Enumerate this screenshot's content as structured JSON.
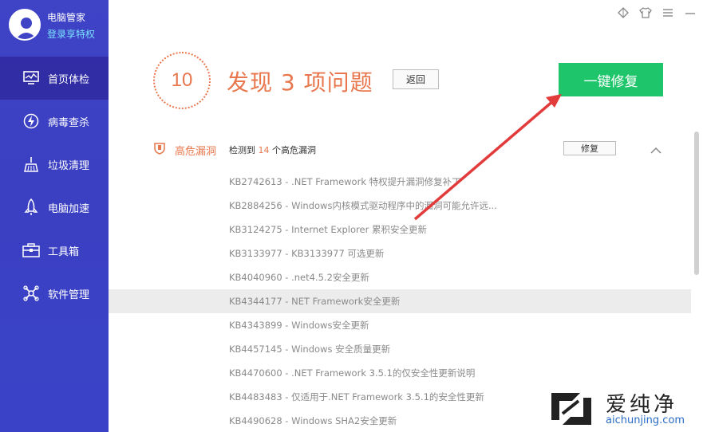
{
  "sidebar": {
    "app_name": "电脑管家",
    "login_text": "登录享特权",
    "items": [
      {
        "label": "首页体检",
        "icon": "monitor-icon",
        "active": true
      },
      {
        "label": "病毒查杀",
        "icon": "lightning-icon",
        "active": false
      },
      {
        "label": "垃圾清理",
        "icon": "broom-icon",
        "active": false
      },
      {
        "label": "电脑加速",
        "icon": "rocket-icon",
        "active": false
      },
      {
        "label": "工具箱",
        "icon": "toolbox-icon",
        "active": false
      },
      {
        "label": "软件管理",
        "icon": "apps-icon",
        "active": false
      }
    ]
  },
  "window_controls": [
    "diamond-icon",
    "shirt-icon",
    "menu-icon",
    "minimize-icon"
  ],
  "summary": {
    "score": "10",
    "headline": "发现 3 项问题",
    "back_label": "返回",
    "fix_all_label": "一键修复"
  },
  "section": {
    "title": "高危漏洞",
    "detect_prefix": "检测到 ",
    "detect_count": "14",
    "detect_suffix": " 个高危漏洞",
    "fix_label": "修复"
  },
  "items": [
    "KB2742613 - .NET Framework 特权提升漏洞修复补丁",
    "KB2884256 - Windows内核模式驱动程序中的漏洞可能允许远...",
    "KB3124275 - Internet Explorer 累积安全更新",
    "KB3133977 - KB3133977 可选更新",
    "KB4040960 - .net4.5.2安全更新",
    "KB4344177 - NET Framework安全更新",
    "KB4343899 - Windows安全更新",
    "KB4457145 - Windows 安全质量更新",
    "KB4470600 - .NET Framework 3.5.1的仅安全性更新说明",
    "KB4483483 - 仅适用于.NET Framework 3.5.1的安全性更新",
    "KB4490628 - Windows SHA2安全更新"
  ],
  "watermark": {
    "title": "爱纯净",
    "url": "aichunjing.com"
  },
  "colors": {
    "sidebar": "#3f43c6",
    "accent_orange": "#e8774d",
    "green": "#1ec56a",
    "arrow": "#e23b3b"
  }
}
